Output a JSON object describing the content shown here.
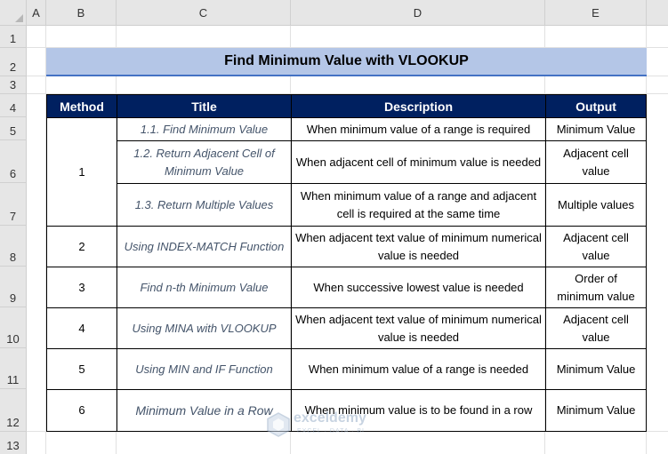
{
  "sheet": {
    "columns": [
      "A",
      "B",
      "C",
      "D",
      "E"
    ],
    "rows": [
      "1",
      "2",
      "3",
      "4",
      "5",
      "6",
      "7",
      "8",
      "9",
      "10",
      "11",
      "12",
      "13"
    ]
  },
  "banner_title": "Find Minimum Value with VLOOKUP",
  "table": {
    "headers": [
      "Method",
      "Title",
      "Description",
      "Output"
    ],
    "methods": [
      "1",
      "2",
      "3",
      "4",
      "5",
      "6"
    ],
    "rows": [
      {
        "title": "1.1. Find Minimum Value",
        "description": "When minimum value of a range is required",
        "output": "Minimum Value"
      },
      {
        "title": "1.2. Return Adjacent Cell of Minimum Value",
        "description": "When adjacent cell of minimum value is needed",
        "output": "Adjacent cell value"
      },
      {
        "title": "1.3. Return Multiple Values",
        "description": "When minimum value of a range and adjacent cell is required at the same time",
        "output": "Multiple values"
      },
      {
        "title": "Using INDEX-MATCH Function",
        "description": "When adjacent text value of minimum numerical value is needed",
        "output": "Adjacent cell value"
      },
      {
        "title": "Find n-th Minimum Value",
        "description": "When successive lowest value is needed",
        "output": "Order of minimum value"
      },
      {
        "title": "Using MINA with VLOOKUP",
        "description": "When adjacent text value of minimum numerical value is needed",
        "output": "Adjacent cell value"
      },
      {
        "title": "Using MIN and IF Function",
        "description": "When minimum value of a range is needed",
        "output": "Minimum Value"
      },
      {
        "title": "Minimum Value in a Row",
        "description": "When minimum value is to be found in a row",
        "output": "Minimum Value"
      }
    ]
  },
  "watermark": {
    "name": "exceldemy",
    "tagline": "EXCEL · DATA · BI"
  }
}
